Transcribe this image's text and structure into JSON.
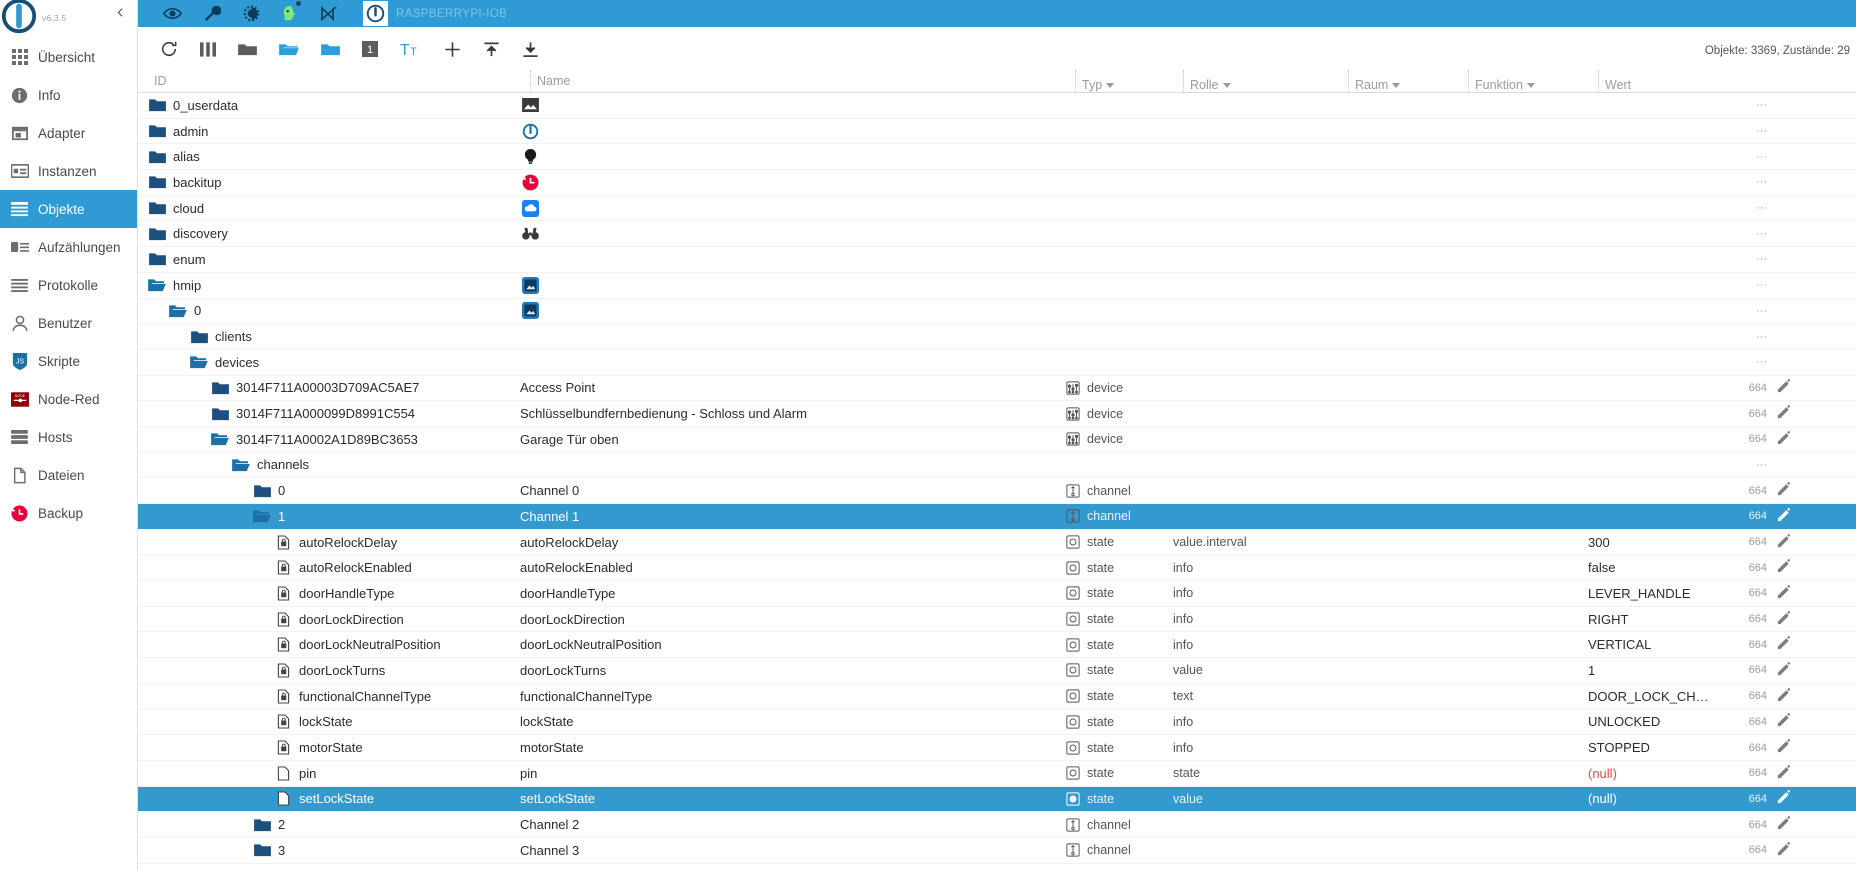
{
  "brand": {
    "version": "v6.3.5",
    "collapse_icon": "chevron-left-icon"
  },
  "sidebar": {
    "items": [
      {
        "label": "Übersicht",
        "icon": "grid-icon",
        "active": false
      },
      {
        "label": "Info",
        "icon": "info-icon",
        "active": false
      },
      {
        "label": "Adapter",
        "icon": "store-icon",
        "active": false
      },
      {
        "label": "Instanzen",
        "icon": "instances-icon",
        "active": false
      },
      {
        "label": "Objekte",
        "icon": "list-icon",
        "active": true
      },
      {
        "label": "Aufzählungen",
        "icon": "enum-icon",
        "active": false
      },
      {
        "label": "Protokolle",
        "icon": "logs-icon",
        "active": false
      },
      {
        "label": "Benutzer",
        "icon": "user-icon",
        "active": false
      },
      {
        "label": "Skripte",
        "icon": "js-icon",
        "active": false
      },
      {
        "label": "Node-Red",
        "icon": "nodered-icon",
        "active": false
      },
      {
        "label": "Hosts",
        "icon": "hosts-icon",
        "active": false
      },
      {
        "label": "Dateien",
        "icon": "files-icon",
        "active": false
      },
      {
        "label": "Backup",
        "icon": "backup-icon",
        "active": false
      }
    ]
  },
  "topbar": {
    "host_name": "RASPBERRYPI-IOB",
    "icons": [
      "eye-icon",
      "wrench-icon",
      "contrast-icon",
      "expert-mode-icon",
      "no-connection-icon",
      "power-icon"
    ]
  },
  "toolbar": {
    "icons": [
      "refresh-icon",
      "columns-icon",
      "collapse-all-icon",
      "expand-all-icon",
      "collapse-one-icon",
      "expand-one-level-icon",
      "text-size-icon",
      "add-icon",
      "upload-icon",
      "download-icon"
    ],
    "counts": "Objekte: 3369, Zustände: 29"
  },
  "columns": [
    {
      "key": "id",
      "label": "ID",
      "filterable": true
    },
    {
      "key": "name",
      "label": "Name",
      "filterable": true
    },
    {
      "key": "typ",
      "label": "Typ",
      "filterable": true
    },
    {
      "key": "role",
      "label": "Rolle",
      "filterable": true
    },
    {
      "key": "room",
      "label": "Raum",
      "filterable": true
    },
    {
      "key": "func",
      "label": "Funktion",
      "filterable": true
    },
    {
      "key": "val",
      "label": "Wert",
      "filterable": false
    }
  ],
  "rows": [
    {
      "indent": 0,
      "icon": "folder-closed-icon",
      "id": "0_userdata",
      "name": "",
      "name_icon": "image-icon",
      "typ": "",
      "typ_icon": "",
      "role": "",
      "val": "",
      "acl": "",
      "edit": false,
      "dots": true,
      "selected": false
    },
    {
      "indent": 0,
      "icon": "folder-closed-icon",
      "id": "admin",
      "name": "",
      "name_icon": "iobroker-icon",
      "typ": "",
      "typ_icon": "",
      "role": "",
      "val": "",
      "acl": "",
      "edit": false,
      "dots": true,
      "selected": false
    },
    {
      "indent": 0,
      "icon": "folder-closed-icon",
      "id": "alias",
      "name": "",
      "name_icon": "bulb-icon",
      "typ": "",
      "typ_icon": "",
      "role": "",
      "val": "",
      "acl": "",
      "edit": false,
      "dots": true,
      "selected": false
    },
    {
      "indent": 0,
      "icon": "folder-closed-icon",
      "id": "backitup",
      "name": "",
      "name_icon": "history-icon",
      "typ": "",
      "typ_icon": "",
      "role": "",
      "val": "",
      "acl": "",
      "edit": false,
      "dots": true,
      "selected": false
    },
    {
      "indent": 0,
      "icon": "folder-closed-icon",
      "id": "cloud",
      "name": "",
      "name_icon": "cloud-icon",
      "typ": "",
      "typ_icon": "",
      "role": "",
      "val": "",
      "acl": "",
      "edit": false,
      "dots": true,
      "selected": false
    },
    {
      "indent": 0,
      "icon": "folder-closed-icon",
      "id": "discovery",
      "name": "",
      "name_icon": "binoculars-icon",
      "typ": "",
      "typ_icon": "",
      "role": "",
      "val": "",
      "acl": "",
      "edit": false,
      "dots": true,
      "selected": false
    },
    {
      "indent": 0,
      "icon": "folder-closed-icon",
      "id": "enum",
      "name": "",
      "name_icon": "",
      "typ": "",
      "typ_icon": "",
      "role": "",
      "val": "",
      "acl": "",
      "edit": false,
      "dots": true,
      "selected": false
    },
    {
      "indent": 0,
      "icon": "folder-open-icon",
      "id": "hmip",
      "name": "",
      "name_icon": "hmip-icon",
      "typ": "",
      "typ_icon": "",
      "role": "",
      "val": "",
      "acl": "",
      "edit": false,
      "dots": true,
      "selected": false
    },
    {
      "indent": 1,
      "icon": "folder-open-icon",
      "id": "0",
      "name": "",
      "name_icon": "hmip-icon",
      "typ": "",
      "typ_icon": "",
      "role": "",
      "val": "",
      "acl": "",
      "edit": false,
      "dots": true,
      "selected": false
    },
    {
      "indent": 2,
      "icon": "folder-closed-icon",
      "id": "clients",
      "name": "",
      "name_icon": "",
      "typ": "",
      "typ_icon": "",
      "role": "",
      "val": "",
      "acl": "",
      "edit": false,
      "dots": true,
      "selected": false
    },
    {
      "indent": 2,
      "icon": "folder-open-icon",
      "id": "devices",
      "name": "",
      "name_icon": "",
      "typ": "",
      "typ_icon": "",
      "role": "",
      "val": "",
      "acl": "",
      "edit": false,
      "dots": true,
      "selected": false
    },
    {
      "indent": 3,
      "icon": "folder-closed-icon",
      "id": "3014F711A00003D709AC5AE7",
      "name": "Access Point",
      "name_icon": "",
      "typ": "device",
      "typ_icon": "device-icon",
      "role": "",
      "val": "",
      "acl": "664",
      "edit": true,
      "dots": false,
      "selected": false
    },
    {
      "indent": 3,
      "icon": "folder-closed-icon",
      "id": "3014F711A000099D8991C554",
      "name": "Schlüsselbundfernbedienung - Schloss und Alarm",
      "name_icon": "",
      "typ": "device",
      "typ_icon": "device-icon",
      "role": "",
      "val": "",
      "acl": "664",
      "edit": true,
      "dots": false,
      "selected": false
    },
    {
      "indent": 3,
      "icon": "folder-open-icon",
      "id": "3014F711A0002A1D89BC3653",
      "name": "Garage Tür oben",
      "name_icon": "",
      "typ": "device",
      "typ_icon": "device-icon",
      "role": "",
      "val": "",
      "acl": "664",
      "edit": true,
      "dots": false,
      "selected": false
    },
    {
      "indent": 4,
      "icon": "folder-open-icon",
      "id": "channels",
      "name": "",
      "name_icon": "",
      "typ": "",
      "typ_icon": "",
      "role": "",
      "val": "",
      "acl": "",
      "edit": false,
      "dots": true,
      "selected": false
    },
    {
      "indent": 5,
      "icon": "folder-closed-icon",
      "id": "0",
      "name": "Channel 0",
      "name_icon": "",
      "typ": "channel",
      "typ_icon": "channel-icon",
      "role": "",
      "val": "",
      "acl": "664",
      "edit": true,
      "dots": false,
      "selected": false
    },
    {
      "indent": 5,
      "icon": "folder-open-icon",
      "id": "1",
      "name": "Channel 1",
      "name_icon": "",
      "typ": "channel",
      "typ_icon": "channel-icon",
      "role": "",
      "val": "",
      "acl": "664",
      "edit": true,
      "dots": false,
      "selected": true
    },
    {
      "indent": 6,
      "icon": "state-ro-icon",
      "id": "autoRelockDelay",
      "name": "autoRelockDelay",
      "name_icon": "",
      "typ": "state",
      "typ_icon": "state-icon",
      "role": "value.interval",
      "val": "300",
      "acl": "664",
      "edit": true,
      "dots": false,
      "selected": false
    },
    {
      "indent": 6,
      "icon": "state-ro-icon",
      "id": "autoRelockEnabled",
      "name": "autoRelockEnabled",
      "name_icon": "",
      "typ": "state",
      "typ_icon": "state-icon",
      "role": "info",
      "val": "false",
      "acl": "664",
      "edit": true,
      "dots": false,
      "selected": false
    },
    {
      "indent": 6,
      "icon": "state-ro-icon",
      "id": "doorHandleType",
      "name": "doorHandleType",
      "name_icon": "",
      "typ": "state",
      "typ_icon": "state-icon",
      "role": "info",
      "val": "LEVER_HANDLE",
      "acl": "664",
      "edit": true,
      "dots": false,
      "selected": false
    },
    {
      "indent": 6,
      "icon": "state-ro-icon",
      "id": "doorLockDirection",
      "name": "doorLockDirection",
      "name_icon": "",
      "typ": "state",
      "typ_icon": "state-icon",
      "role": "info",
      "val": "RIGHT",
      "acl": "664",
      "edit": true,
      "dots": false,
      "selected": false
    },
    {
      "indent": 6,
      "icon": "state-ro-icon",
      "id": "doorLockNeutralPosition",
      "name": "doorLockNeutralPosition",
      "name_icon": "",
      "typ": "state",
      "typ_icon": "state-icon",
      "role": "info",
      "val": "VERTICAL",
      "acl": "664",
      "edit": true,
      "dots": false,
      "selected": false
    },
    {
      "indent": 6,
      "icon": "state-ro-icon",
      "id": "doorLockTurns",
      "name": "doorLockTurns",
      "name_icon": "",
      "typ": "state",
      "typ_icon": "state-icon",
      "role": "value",
      "val": "1",
      "acl": "664",
      "edit": true,
      "dots": false,
      "selected": false
    },
    {
      "indent": 6,
      "icon": "state-ro-icon",
      "id": "functionalChannelType",
      "name": "functionalChannelType",
      "name_icon": "",
      "typ": "state",
      "typ_icon": "state-icon",
      "role": "text",
      "val": "DOOR_LOCK_CH…",
      "acl": "664",
      "edit": true,
      "dots": false,
      "selected": false
    },
    {
      "indent": 6,
      "icon": "state-ro-icon",
      "id": "lockState",
      "name": "lockState",
      "name_icon": "",
      "typ": "state",
      "typ_icon": "state-icon",
      "role": "info",
      "val": "UNLOCKED",
      "acl": "664",
      "edit": true,
      "dots": false,
      "selected": false
    },
    {
      "indent": 6,
      "icon": "state-ro-icon",
      "id": "motorState",
      "name": "motorState",
      "name_icon": "",
      "typ": "state",
      "typ_icon": "state-icon",
      "role": "info",
      "val": "STOPPED",
      "acl": "664",
      "edit": true,
      "dots": false,
      "selected": false
    },
    {
      "indent": 6,
      "icon": "state-rw-icon",
      "id": "pin",
      "name": "pin",
      "name_icon": "",
      "typ": "state",
      "typ_icon": "state-icon",
      "role": "state",
      "val": "(null)",
      "acl": "664",
      "edit": true,
      "dots": false,
      "selected": false,
      "null": true
    },
    {
      "indent": 6,
      "icon": "state-rw-icon",
      "id": "setLockState",
      "name": "setLockState",
      "name_icon": "",
      "typ": "state",
      "typ_icon": "state-write-icon",
      "role": "value",
      "val": "(null)",
      "acl": "664",
      "edit": true,
      "dots": false,
      "selected": true,
      "null": true
    },
    {
      "indent": 5,
      "icon": "folder-closed-icon",
      "id": "2",
      "name": "Channel 2",
      "name_icon": "",
      "typ": "channel",
      "typ_icon": "channel-icon",
      "role": "",
      "val": "",
      "acl": "664",
      "edit": true,
      "dots": false,
      "selected": false
    },
    {
      "indent": 5,
      "icon": "folder-closed-icon",
      "id": "3",
      "name": "Channel 3",
      "name_icon": "",
      "typ": "channel",
      "typ_icon": "channel-icon",
      "role": "",
      "val": "",
      "acl": "664",
      "edit": true,
      "dots": false,
      "selected": false
    }
  ],
  "colors": {
    "accent": "#2f9bd4",
    "selected_row": "#3399cf",
    "null_text": "#e04a3f",
    "folder": "#1d4f7f"
  }
}
